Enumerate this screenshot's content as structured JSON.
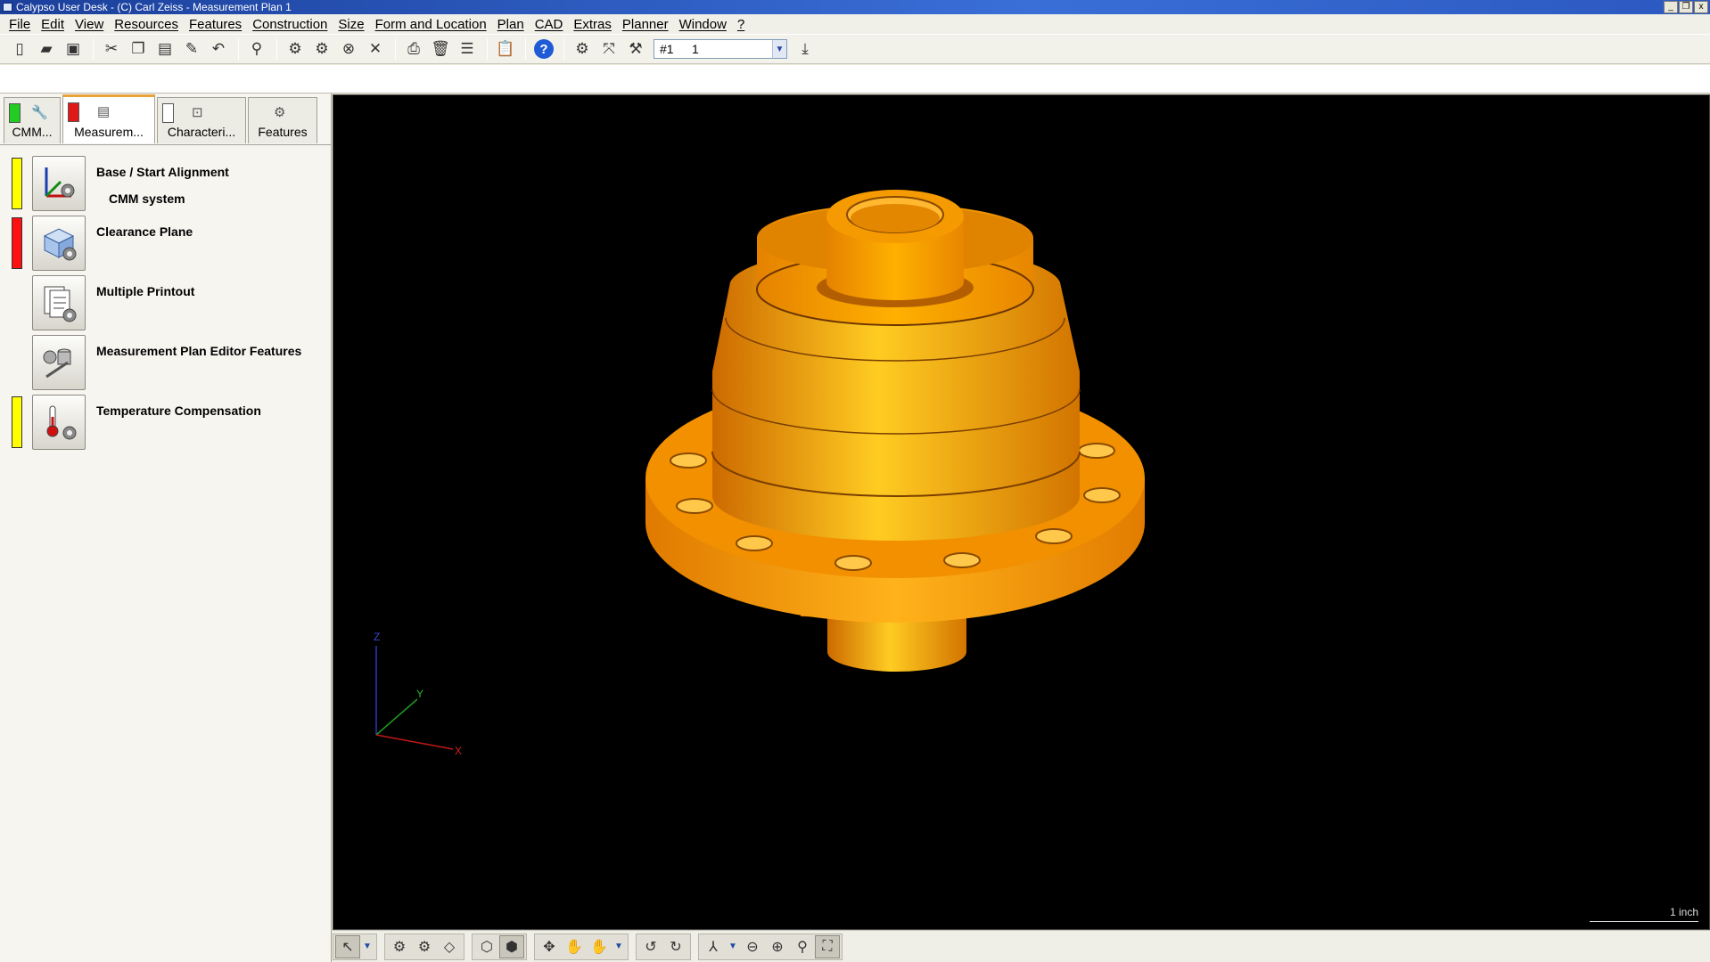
{
  "window": {
    "title": "Calypso User Desk - (C) Carl Zeiss - Measurement Plan 1",
    "controls": [
      "_",
      "❐",
      "x"
    ]
  },
  "menu": [
    "File",
    "Edit",
    "View",
    "Resources",
    "Features",
    "Construction",
    "Size",
    "Form and Location",
    "Plan",
    "CAD",
    "Extras",
    "Planner",
    "Window",
    "?"
  ],
  "toolbar": {
    "combo_id": "#1",
    "combo_value": "1",
    "combo_arrow": "▼"
  },
  "tabs": [
    {
      "label": "CMM...",
      "indicator": "#22cc22"
    },
    {
      "label": "Measurem...",
      "indicator": "#e01818"
    },
    {
      "label": "Characteri...",
      "indicator": "#ffffff"
    },
    {
      "label": "Features"
    }
  ],
  "plan_items": [
    {
      "label": "Base / Start Alignment",
      "sub": "CMM system",
      "status": "#ffff00",
      "icon": "alignment-icon"
    },
    {
      "label": "Clearance Plane",
      "status": "#ff1010",
      "icon": "clearance-plane-icon"
    },
    {
      "label": "Multiple Printout",
      "icon": "printout-icon"
    },
    {
      "label": "Measurement Plan Editor Features",
      "icon": "editor-features-icon"
    },
    {
      "label": "Temperature Compensation",
      "status": "#ffff00",
      "icon": "thermometer-icon"
    }
  ],
  "viewport": {
    "axes": {
      "z": "Z",
      "y": "Y",
      "x": "X"
    },
    "scale_label": "1 inch",
    "part_color": "#ff9900"
  }
}
